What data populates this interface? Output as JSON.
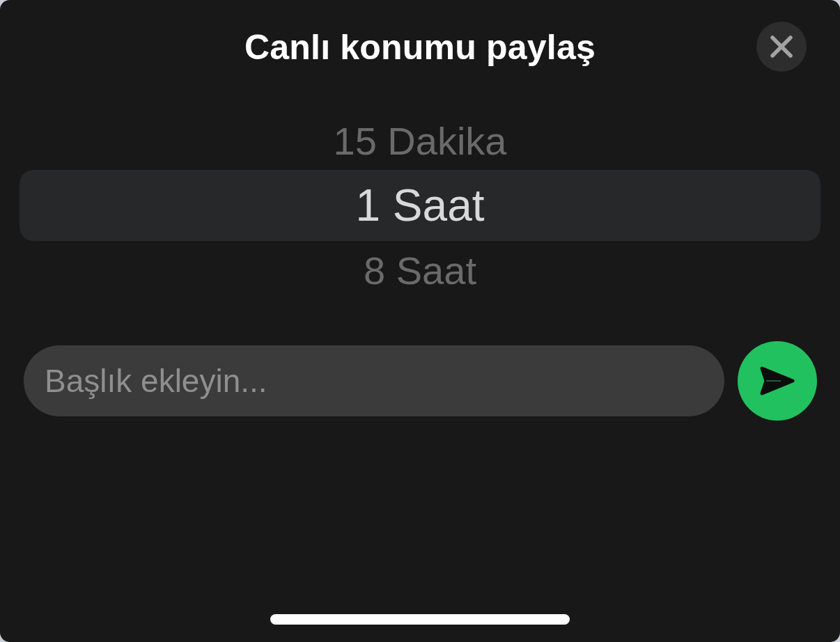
{
  "sheet": {
    "title": "Canlı konumu paylaş"
  },
  "duration_picker": {
    "options": [
      {
        "label": "15 Dakika",
        "selected": false
      },
      {
        "label": "1 Saat",
        "selected": true
      },
      {
        "label": "8 Saat",
        "selected": false
      }
    ]
  },
  "caption_field": {
    "placeholder": "Başlık ekleyin..."
  }
}
